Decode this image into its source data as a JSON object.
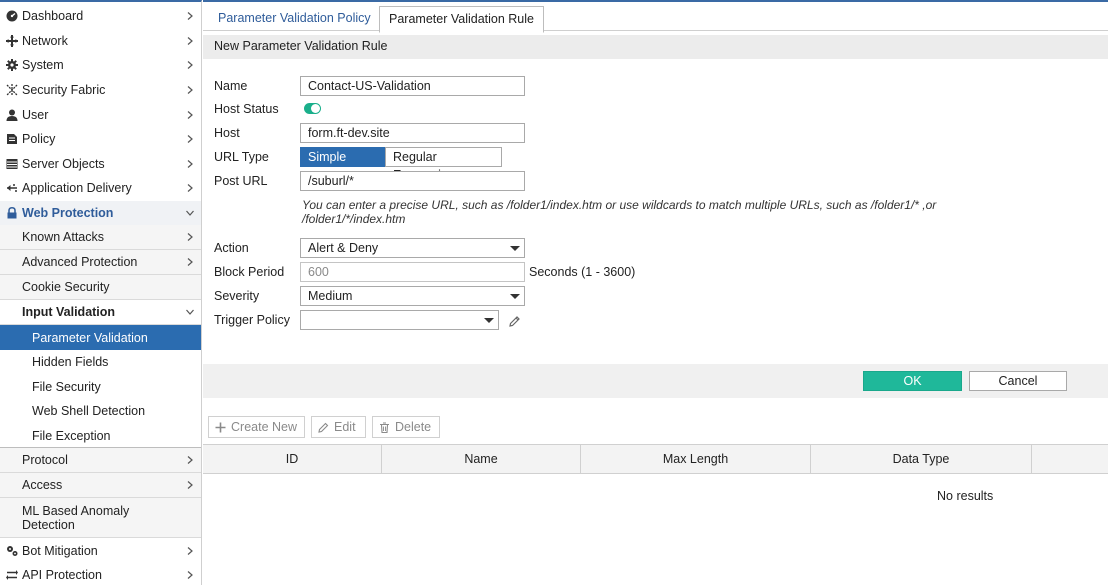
{
  "sidebar": {
    "items": [
      {
        "label": "Dashboard",
        "icon": "dashboard-icon"
      },
      {
        "label": "Network",
        "icon": "network-icon"
      },
      {
        "label": "System",
        "icon": "gear-icon"
      },
      {
        "label": "Security Fabric",
        "icon": "fabric-icon"
      },
      {
        "label": "User",
        "icon": "user-icon"
      },
      {
        "label": "Policy",
        "icon": "policy-icon"
      },
      {
        "label": "Server Objects",
        "icon": "server-icon"
      },
      {
        "label": "Application Delivery",
        "icon": "delivery-icon"
      },
      {
        "label": "Web Protection",
        "icon": "lock-icon"
      }
    ],
    "web_protection_children": [
      {
        "label": "Known Attacks"
      },
      {
        "label": "Advanced Protection"
      },
      {
        "label": "Cookie Security"
      },
      {
        "label": "Input Validation"
      }
    ],
    "input_validation_children": [
      {
        "label": "Parameter Validation"
      },
      {
        "label": "Hidden Fields"
      },
      {
        "label": "File Security"
      },
      {
        "label": "Web Shell Detection"
      },
      {
        "label": "File Exception"
      }
    ],
    "more_children": [
      {
        "label": "Protocol"
      },
      {
        "label": "Access"
      },
      {
        "label": "ML Based Anomaly Detection"
      }
    ],
    "bottom_items": [
      {
        "label": "Bot Mitigation",
        "icon": "bot-icon"
      },
      {
        "label": "API Protection",
        "icon": "api-icon"
      }
    ]
  },
  "tabs": [
    {
      "label": "Parameter Validation Policy"
    },
    {
      "label": "Parameter Validation Rule"
    }
  ],
  "section_title": "New Parameter Validation Rule",
  "form": {
    "name_label": "Name",
    "name_value": "Contact-US-Validation",
    "host_status_label": "Host Status",
    "host_status_on": true,
    "host_label": "Host",
    "host_value": "form.ft-dev.site",
    "url_type_label": "URL Type",
    "url_type_options": [
      "Simple String",
      "Regular Expression"
    ],
    "post_url_label": "Post URL",
    "post_url_value": "/suburl/*",
    "hint": "You can enter a precise URL, such as /folder1/index.htm or use wildcards to match multiple URLs, such as /folder1/* ,or /folder1/*/index.htm",
    "action_label": "Action",
    "action_value": "Alert & Deny",
    "block_period_label": "Block Period",
    "block_period_value": "600",
    "block_period_suffix": "Seconds (1 - 3600)",
    "severity_label": "Severity",
    "severity_value": "Medium",
    "trigger_policy_label": "Trigger Policy",
    "trigger_policy_value": ""
  },
  "buttons": {
    "ok": "OK",
    "cancel": "Cancel"
  },
  "toolbar": {
    "create_new": "Create New",
    "edit": "Edit",
    "delete": "Delete"
  },
  "table": {
    "columns": [
      "ID",
      "Name",
      "Max Length",
      "Data Type"
    ],
    "empty_text": "No results"
  },
  "colors": {
    "accent_blue": "#2b6cb0",
    "ok_green": "#1fb89a",
    "toggle_green": "#1aaf8b"
  }
}
